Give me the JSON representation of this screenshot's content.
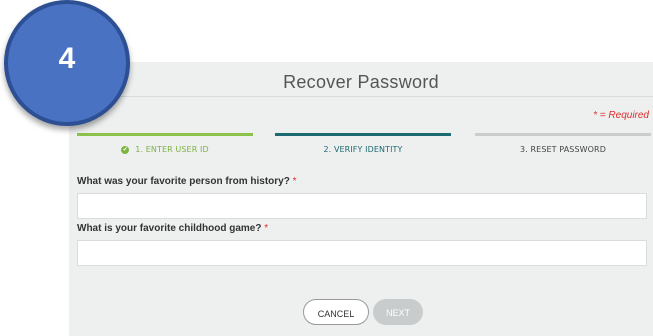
{
  "badge": {
    "number": "4"
  },
  "page": {
    "title": "Recover Password",
    "required_note": "* = Required"
  },
  "steps": [
    {
      "label": "1. ENTER USER ID",
      "state": "complete"
    },
    {
      "label": "2. VERIFY IDENTITY",
      "state": "active"
    },
    {
      "label": "3. RESET PASSWORD",
      "state": "pending"
    }
  ],
  "questions": [
    {
      "label": "What was your favorite person from history?",
      "required_mark": "*",
      "value": ""
    },
    {
      "label": "What is your favorite childhood game?",
      "required_mark": "*",
      "value": ""
    }
  ],
  "buttons": {
    "cancel": "CANCEL",
    "next": "NEXT"
  },
  "colors": {
    "complete": "#8bc34a",
    "active": "#1c6a72",
    "pending": "#cccccc",
    "required": "#e02b2b",
    "badge": "#4a72c2"
  }
}
